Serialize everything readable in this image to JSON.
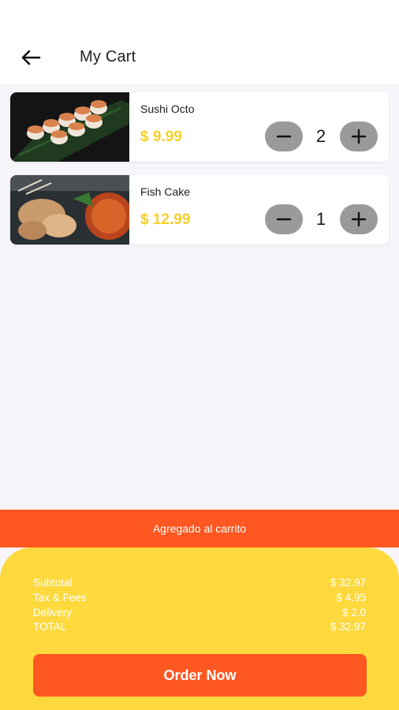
{
  "header": {
    "title": "My Cart"
  },
  "cart": {
    "items": [
      {
        "name": "Sushi Octo",
        "price": "$ 9.99",
        "quantity": "2"
      },
      {
        "name": "Fish Cake",
        "price": "$ 12.99",
        "quantity": "1"
      }
    ]
  },
  "toast": {
    "message": "Agregado al carrito"
  },
  "summary": {
    "rows": [
      {
        "label": "Subtotal",
        "value": "$ 32.97"
      },
      {
        "label": "Tax & Fees",
        "value": "$ 4.95"
      },
      {
        "label": "Delivery",
        "value": "$ 2.0"
      },
      {
        "label": "TOTAL",
        "value": "$ 32.97"
      }
    ],
    "order_label": "Order Now"
  },
  "colors": {
    "accent_orange": "#fe5721",
    "accent_yellow": "#fed93e",
    "price_yellow": "#f6cf2c",
    "stepper_gray": "#9a9a9a"
  },
  "icons": {
    "back": "arrow-left-icon",
    "minus": "minus-icon",
    "plus": "plus-icon"
  }
}
